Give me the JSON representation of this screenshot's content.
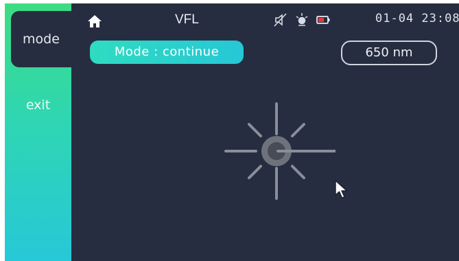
{
  "header": {
    "title": "VFL",
    "clock": "01-04 23:08"
  },
  "sidebar": {
    "items": [
      {
        "label": "mode",
        "selected": true
      },
      {
        "label": "exit",
        "selected": false
      }
    ]
  },
  "main": {
    "mode_label": "Mode : continue",
    "wavelength_label": "650 nm"
  },
  "icons": {
    "home": "home-icon",
    "mute": "speaker-off-icon",
    "light": "light-source-icon",
    "battery": "battery-low-icon",
    "laser": "laser-emitting-icon",
    "cursor": "mouse-pointer-icon"
  },
  "colors": {
    "background": "#272d40",
    "sidebar_top": "#3ddc82",
    "sidebar_bottom": "#27c8d8",
    "battery_low": "#e53b3b"
  }
}
